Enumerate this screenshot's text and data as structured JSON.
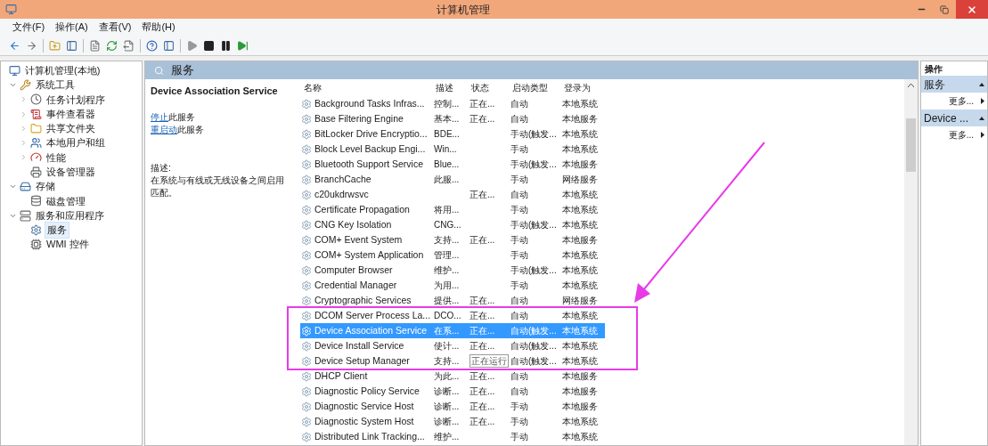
{
  "window": {
    "title": "计算机管理"
  },
  "menu": [
    "文件(F)",
    "操作(A)",
    "查看(V)",
    "帮助(H)"
  ],
  "tree": [
    {
      "label": "计算机管理(本地)",
      "selected": false,
      "children": [
        {
          "label": "系统工具",
          "expanded": true,
          "selected": false,
          "children": [
            {
              "label": "任务计划程序",
              "expanded": false,
              "selected": false
            },
            {
              "label": "事件查看器",
              "expanded": false,
              "selected": false
            },
            {
              "label": "共享文件夹",
              "expanded": false,
              "selected": false
            },
            {
              "label": "本地用户和组",
              "expanded": false,
              "selected": false
            },
            {
              "label": "性能",
              "expanded": false,
              "selected": false
            },
            {
              "label": "设备管理器",
              "selected": false
            }
          ]
        },
        {
          "label": "存储",
          "expanded": true,
          "selected": false,
          "children": [
            {
              "label": "磁盘管理",
              "selected": false
            }
          ]
        },
        {
          "label": "服务和应用程序",
          "expanded": true,
          "selected": false,
          "children": [
            {
              "label": "服务",
              "selected": true
            },
            {
              "label": "WMI 控件",
              "selected": false
            }
          ]
        }
      ]
    }
  ],
  "pane": {
    "title": "服务",
    "service_name": "Device Association Service",
    "actions": [
      {
        "link": "停止",
        "text": "此服务"
      },
      {
        "link": "重启动",
        "text": "此服务"
      }
    ],
    "description_label": "描述:",
    "description": "在系统与有线或无线设备之间启用匹配。"
  },
  "table": {
    "columns": [
      "名称",
      "描述",
      "状态",
      "启动类型",
      "登录为"
    ],
    "rows": [
      {
        "name": "Background Tasks Infras...",
        "description": "控制...",
        "status": "正在...",
        "startup": "自动",
        "logon": "本地系统",
        "selected": false
      },
      {
        "name": "Base Filtering Engine",
        "description": "基本...",
        "status": "正在...",
        "startup": "自动",
        "logon": "本地服务",
        "selected": false
      },
      {
        "name": "BitLocker Drive Encryptio...",
        "description": "BDE...",
        "status": "",
        "startup": "手动(触发...",
        "logon": "本地系统",
        "selected": false
      },
      {
        "name": "Block Level Backup Engi...",
        "description": "Win...",
        "status": "",
        "startup": "手动",
        "logon": "本地系统",
        "selected": false
      },
      {
        "name": "Bluetooth Support Service",
        "description": "Blue...",
        "status": "",
        "startup": "手动(触发...",
        "logon": "本地服务",
        "selected": false
      },
      {
        "name": "BranchCache",
        "description": "此服...",
        "status": "",
        "startup": "手动",
        "logon": "网络服务",
        "selected": false
      },
      {
        "name": "c20ukdrwsvc",
        "description": "",
        "status": "正在...",
        "startup": "自动",
        "logon": "本地系统",
        "selected": false
      },
      {
        "name": "Certificate Propagation",
        "description": "将用...",
        "status": "",
        "startup": "手动",
        "logon": "本地系统",
        "selected": false
      },
      {
        "name": "CNG Key Isolation",
        "description": "CNG...",
        "status": "",
        "startup": "手动(触发...",
        "logon": "本地系统",
        "selected": false
      },
      {
        "name": "COM+ Event System",
        "description": "支持...",
        "status": "正在...",
        "startup": "手动",
        "logon": "本地服务",
        "selected": false
      },
      {
        "name": "COM+ System Application",
        "description": "管理...",
        "status": "",
        "startup": "手动",
        "logon": "本地系统",
        "selected": false
      },
      {
        "name": "Computer Browser",
        "description": "维护...",
        "status": "",
        "startup": "手动(触发...",
        "logon": "本地系统",
        "selected": false
      },
      {
        "name": "Credential Manager",
        "description": "为用...",
        "status": "",
        "startup": "手动",
        "logon": "本地系统",
        "selected": false
      },
      {
        "name": "Cryptographic Services",
        "description": "提供...",
        "status": "正在...",
        "startup": "自动",
        "logon": "网络服务",
        "selected": false
      },
      {
        "name": "DCOM Server Process La...",
        "description": "DCO...",
        "status": "正在...",
        "startup": "自动",
        "logon": "本地系统",
        "selected": false
      },
      {
        "name": "Device Association Service",
        "description": "在系...",
        "status": "正在...",
        "startup": "自动(触发...",
        "logon": "本地系统",
        "selected": true
      },
      {
        "name": "Device Install Service",
        "description": "使计...",
        "status": "正在...",
        "startup": "自动(触发...",
        "logon": "本地系统",
        "selected": false
      },
      {
        "name": "Device Setup Manager",
        "description": "支持...",
        "status": "",
        "tooltip": "正在运行",
        "startup": "自动(触发...",
        "logon": "本地系统",
        "selected": false
      },
      {
        "name": "DHCP Client",
        "description": "为此...",
        "status": "正在...",
        "startup": "自动",
        "logon": "本地服务",
        "selected": false
      },
      {
        "name": "Diagnostic Policy Service",
        "description": "诊断...",
        "status": "正在...",
        "startup": "自动",
        "logon": "本地服务",
        "selected": false
      },
      {
        "name": "Diagnostic Service Host",
        "description": "诊断...",
        "status": "正在...",
        "startup": "手动",
        "logon": "本地服务",
        "selected": false
      },
      {
        "name": "Diagnostic System Host",
        "description": "诊断...",
        "status": "正在...",
        "startup": "手动",
        "logon": "本地系统",
        "selected": false
      },
      {
        "name": "Distributed Link Tracking...",
        "description": "维护...",
        "status": "",
        "startup": "手动",
        "logon": "本地系统",
        "selected": false
      }
    ]
  },
  "actions": {
    "title": "操作",
    "sections": [
      {
        "title": "服务",
        "expanded": true,
        "items": [
          "更多..."
        ]
      },
      {
        "title": "Device ...",
        "expanded": true,
        "items": [
          "更多..."
        ]
      }
    ]
  }
}
